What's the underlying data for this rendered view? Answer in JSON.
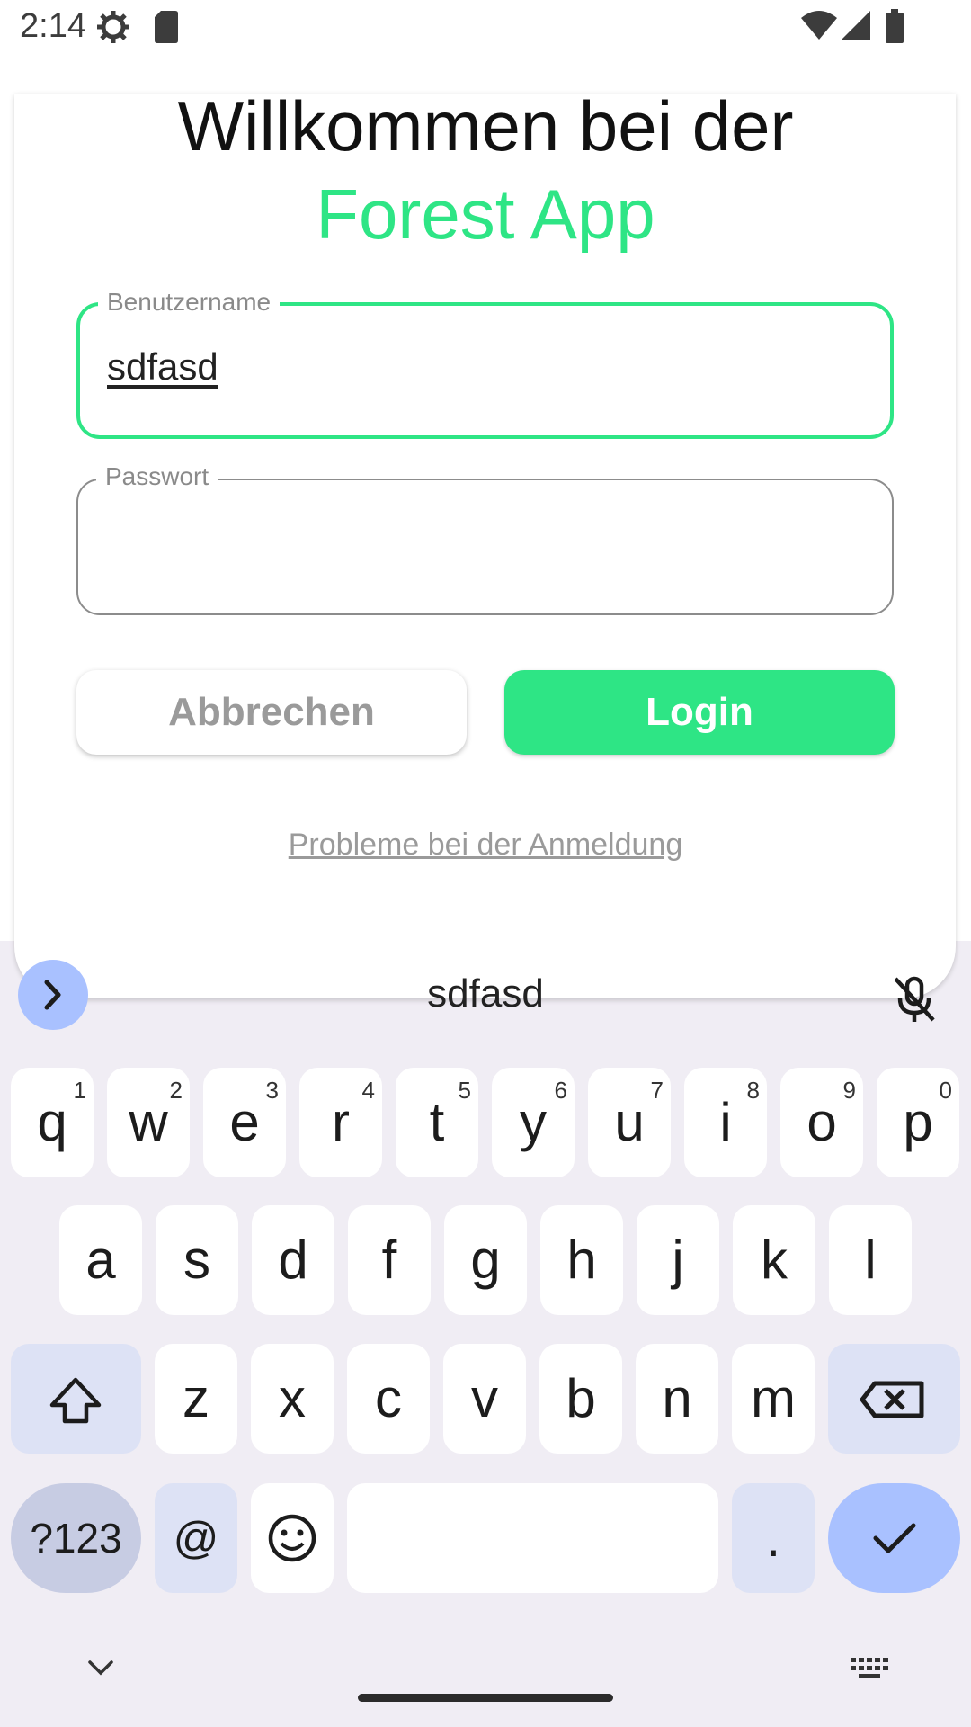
{
  "status_bar": {
    "time": "2:14",
    "icons": [
      "settings-gear-icon",
      "sim-card-icon",
      "wifi-icon",
      "cellular-signal-icon",
      "battery-icon"
    ]
  },
  "login": {
    "title_line1": "Willkommen bei der",
    "title_line2": "Forest App",
    "username": {
      "label": "Benutzername",
      "value": "sdfasd"
    },
    "password": {
      "label": "Passwort",
      "value": ""
    },
    "cancel_label": "Abbrechen",
    "login_label": "Login",
    "help_link": "Probleme bei der Anmeldung"
  },
  "colors": {
    "accent": "#2ee585",
    "keyboard_bg": "#f0edf4",
    "enter_key": "#a9c1ff"
  },
  "keyboard": {
    "suggestion": "sdfasd",
    "row1": [
      {
        "k": "q",
        "h": "1"
      },
      {
        "k": "w",
        "h": "2"
      },
      {
        "k": "e",
        "h": "3"
      },
      {
        "k": "r",
        "h": "4"
      },
      {
        "k": "t",
        "h": "5"
      },
      {
        "k": "y",
        "h": "6"
      },
      {
        "k": "u",
        "h": "7"
      },
      {
        "k": "i",
        "h": "8"
      },
      {
        "k": "o",
        "h": "9"
      },
      {
        "k": "p",
        "h": "0"
      }
    ],
    "row2": [
      "a",
      "s",
      "d",
      "f",
      "g",
      "h",
      "j",
      "k",
      "l"
    ],
    "row3": [
      "z",
      "x",
      "c",
      "v",
      "b",
      "n",
      "m"
    ],
    "symbols_label": "?123",
    "at_label": "@",
    "period_label": "."
  }
}
